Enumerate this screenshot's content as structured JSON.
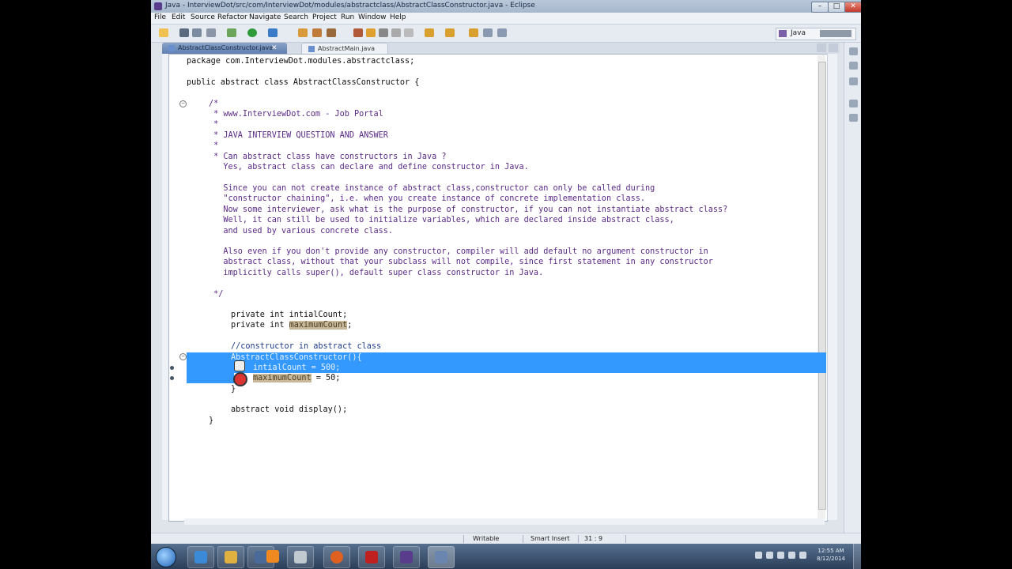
{
  "window": {
    "title": "Java - InterviewDot/src/com/InterviewDot/modules/abstractclass/AbstractClassConstructor.java - Eclipse"
  },
  "menu": [
    "File",
    "Edit",
    "Source",
    "Refactor",
    "Navigate",
    "Search",
    "Project",
    "Run",
    "Window",
    "Help"
  ],
  "perspective": {
    "label": "Java"
  },
  "tabs": [
    {
      "label": "AbstractClassConstructor.java",
      "active": true
    },
    {
      "label": "AbstractMain.java",
      "active": false
    }
  ],
  "code": {
    "l1": "package com.InterviewDot.modules.abstractclass;",
    "l2": "public abstract class AbstractClassConstructor {",
    "c_open": "/*",
    "c1": " * www.InterviewDot.com - Job Portal",
    "c_star": " *",
    "c2": " * JAVA INTERVIEW QUESTION AND ANSWER",
    "c3": " * Can abstract class have constructors in Java ?",
    "c4": "   Yes, abstract class can declare and define constructor in Java.",
    "c5": "   Since you can not create instance of abstract class,constructor can only be called during",
    "c6": "   \"constructor chaining\", i.e. when you create instance of concrete implementation class.",
    "c7": "   Now some interviewer, ask what is the purpose of constructor, if you can not instantiate abstract class?",
    "c8": "   Well, it can still be used to initialize variables, which are declared inside abstract class,",
    "c9": "   and used by various concrete class.",
    "c10": "   Also even if you don't provide any constructor, compiler will add default no argument constructor in",
    "c11": "   abstract class, without that your subclass will not compile, since first statement in any constructor",
    "c12": "   implicitly calls super(), default super class constructor in Java.",
    "c_close": " */",
    "f1": "private int intialCount;",
    "f2_prefix": "private int ",
    "f2_var": "maximumCount",
    "f2_suffix": ";",
    "cm_inline": "//constructor in abstract class",
    "ctor": "AbstractClassConstructor(){",
    "ctor_b1": "intialCount = 500;",
    "ctor_b2_var": "maximumCount",
    "ctor_b2_rest": " = 50;",
    "ctor_close": "}",
    "abs": "abstract void display();",
    "class_close": "}"
  },
  "status": {
    "writable": "Writable",
    "insert_mode": "Smart Insert",
    "position": "31 : 9"
  },
  "clock": {
    "time": "12:55 AM",
    "date": "8/12/2014"
  },
  "colors": {
    "selection": "#3399ff",
    "comment": "#5b2a86",
    "taskbar": "#2b3e58"
  }
}
